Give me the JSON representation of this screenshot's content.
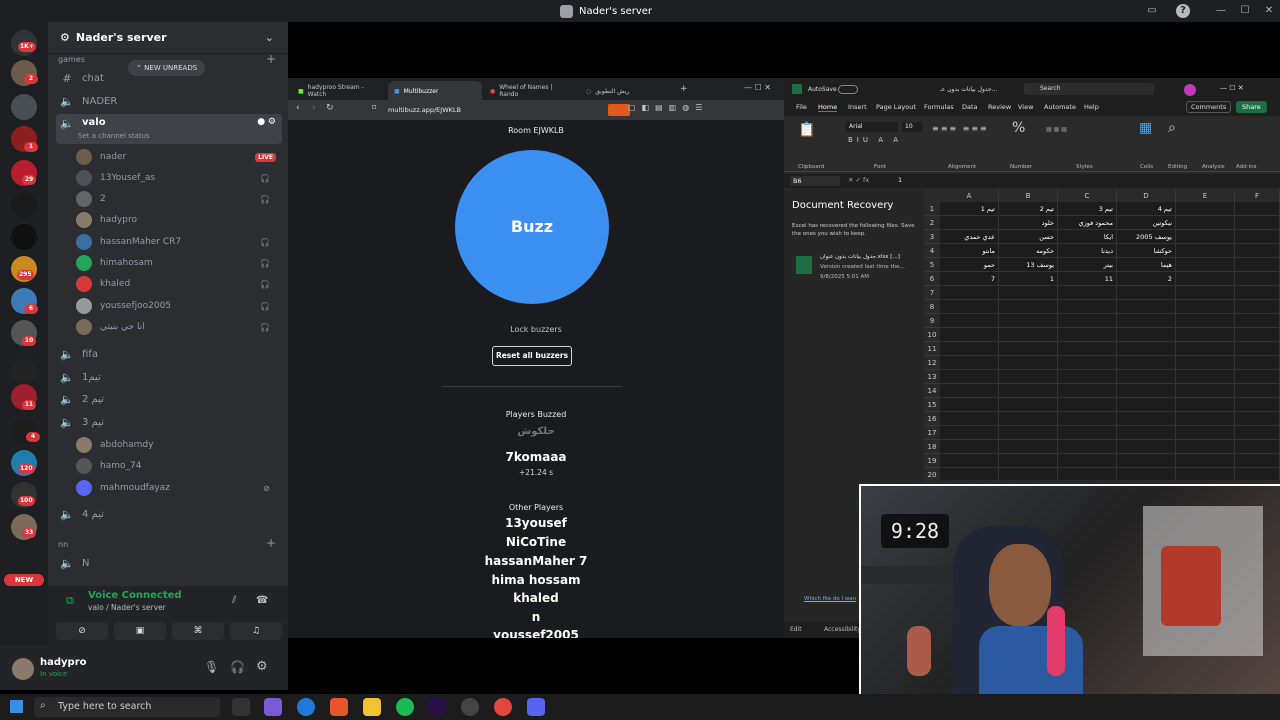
{
  "window": {
    "title": "Nader's server"
  },
  "rail": {
    "badges": [
      "1K+",
      "2",
      "1",
      "29",
      "295",
      "6",
      "10",
      "11",
      "4",
      "120",
      "100",
      "33"
    ],
    "new_label": "NEW"
  },
  "sidebar": {
    "server_name": "Nader's server",
    "new_unreads": "NEW UNREADS",
    "categories": [
      "games",
      "nn"
    ],
    "channels": {
      "chat": "chat",
      "nader": "NADER",
      "valo": "valo",
      "valo_status": "Set a channel status",
      "fifa": "fifa",
      "team1": "تيم1",
      "team2": "تيم 2",
      "team3": "تيم 3",
      "team4": "تيم 4",
      "n": "N"
    },
    "valo_users": [
      "nader",
      "13Yousef_as",
      "2",
      "hadypro",
      "hassanMaher CR7",
      "himahosam",
      "khaled",
      "youssefjoo2005",
      "انا جي بنيتي"
    ],
    "live_label": "LIVE",
    "team3_users": [
      "abdohamdy",
      "hamo_74",
      "mahmoudfayaz"
    ]
  },
  "voice": {
    "status": "Voice Connected",
    "location": "valo / Nader's server"
  },
  "user": {
    "name": "hadypro",
    "status": "In voice"
  },
  "browser": {
    "tabs": [
      "hadyproo Stream - Watch",
      "Multibuzzer",
      "Wheel of Names | Rando",
      "ريش التطويق"
    ],
    "url": "multibuzz.app/EJWKLB"
  },
  "buzzer": {
    "room": "Room EJWKLB",
    "buzz_label": "Buzz",
    "lock_label": "Lock buzzers",
    "reset_label": "Reset all buzzers",
    "players_buzzed_title": "Players Buzzed",
    "buzzed": [
      {
        "name": "حلكوش",
        "time": ""
      },
      {
        "name": "7komaaa",
        "time": "+21.24 s"
      }
    ],
    "other_title": "Other Players",
    "others": [
      "13yousef",
      "NiCoTine",
      "hassanMaher 7",
      "hima hossam",
      "khaled",
      "n",
      "youssef2005"
    ]
  },
  "excel": {
    "autosave": "AutoSave",
    "filename": "جدول بيانات بدون عـ...",
    "search": "Search",
    "menus": [
      "File",
      "Home",
      "Insert",
      "Page Layout",
      "Formulas",
      "Data",
      "Review",
      "View",
      "Automate",
      "Help"
    ],
    "comments": "Comments",
    "share": "Share",
    "groups": [
      "Clipboard",
      "Font",
      "Alignment",
      "Number",
      "Styles",
      "Cells",
      "Editing",
      "Analysis",
      "Add-ins"
    ],
    "font": "Arial",
    "font_size": "10",
    "cell_ref": "B6",
    "formula_value": "1",
    "recovery": {
      "title": "Document Recovery",
      "desc": "Excel has recovered the following files. Save the ones you wish to keep.",
      "file": "جدول بيانات بدون عنوان.xlsx [...]",
      "file_sub": "Version created last time the...",
      "file_date": "9/8/2025 5:01 AM",
      "link": "Which file do I wan"
    },
    "columns": [
      "A",
      "B",
      "C",
      "D",
      "E",
      "F"
    ],
    "rows": [
      [
        "تيم 1",
        "تيم 2",
        "تيم 3",
        "تيم 4",
        "",
        ""
      ],
      [
        "",
        "خلود",
        "محمود فوزي",
        "نيكوتين",
        "",
        ""
      ],
      [
        "عدي حمدي",
        "حسن",
        "ايكا",
        "يوسف 2005",
        "",
        ""
      ],
      [
        "مانتو",
        "حكومه",
        "ديدنا",
        "حوكشا",
        "",
        ""
      ],
      [
        "حمو",
        "يوسف 13",
        "بيتر",
        "هيما",
        "",
        ""
      ],
      [
        "7",
        "1",
        "11",
        "2",
        "",
        ""
      ],
      [
        "",
        "",
        "",
        "",
        "",
        ""
      ],
      [
        "",
        "",
        "",
        "",
        "",
        ""
      ],
      [
        "",
        "",
        "",
        "",
        "",
        ""
      ],
      [
        "",
        "",
        "",
        "",
        "",
        ""
      ],
      [
        "",
        "",
        "",
        "",
        "",
        ""
      ],
      [
        "",
        "",
        "",
        "",
        "",
        ""
      ],
      [
        "",
        "",
        "",
        "",
        "",
        ""
      ],
      [
        "",
        "",
        "",
        "",
        "",
        ""
      ],
      [
        "",
        "",
        "",
        "",
        "",
        ""
      ],
      [
        "",
        "",
        "",
        "",
        "",
        ""
      ],
      [
        "",
        "",
        "",
        "",
        "",
        ""
      ],
      [
        "",
        "",
        "",
        "",
        "",
        ""
      ],
      [
        "",
        "",
        "",
        "",
        "",
        ""
      ],
      [
        "",
        "",
        "",
        "",
        "",
        ""
      ]
    ],
    "status_edit": "Edit",
    "status_accessibility": "Accessibility"
  },
  "webcam": {
    "clock": "9:28"
  },
  "taskbar": {
    "search_placeholder": "Type here to search"
  }
}
